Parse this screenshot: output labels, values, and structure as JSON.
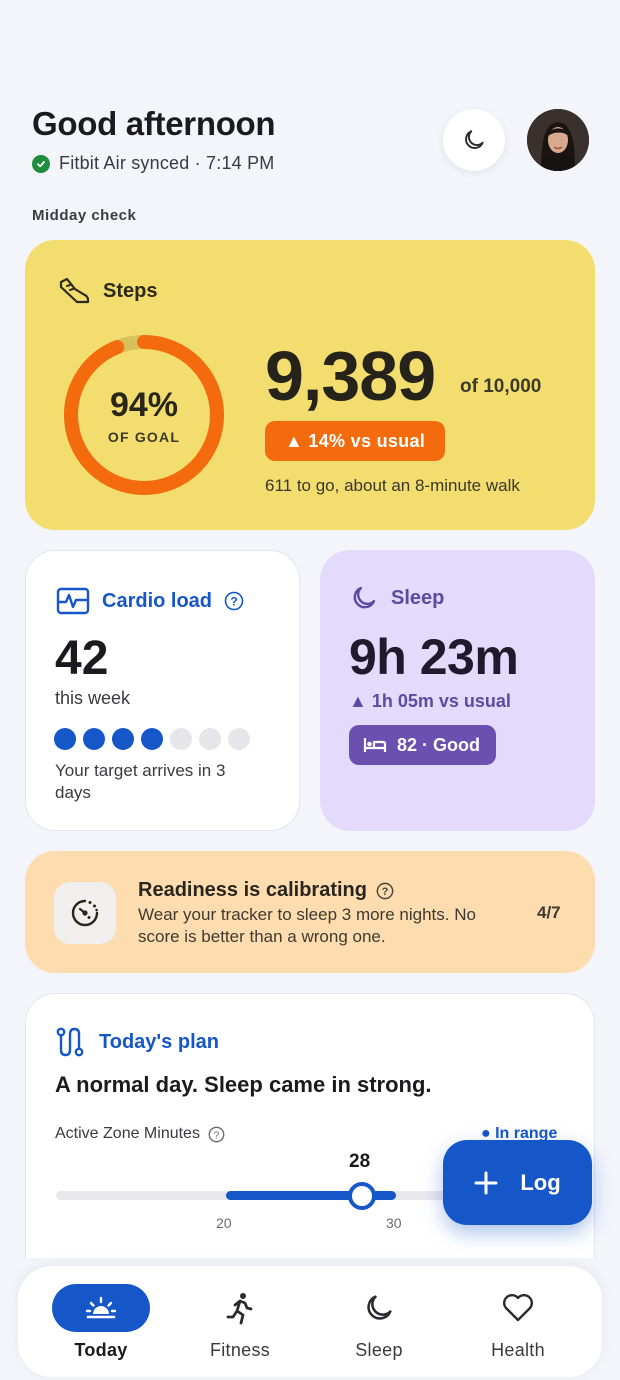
{
  "header": {
    "greeting": "Good afternoon",
    "sync_status": "Fitbit Air synced · 7:14 PM"
  },
  "section_label": "Midday check",
  "steps": {
    "title": "Steps",
    "goal_percent_label": "94%",
    "goal_percent": 0.94,
    "of_goal_label": "OF GOAL",
    "value": "9,389",
    "goal_label": "of 10,000",
    "badge": "▲ 14% vs usual",
    "note": "611 to go, about an 8-minute walk",
    "color_ring": "#f36b0d"
  },
  "cardio": {
    "title": "Cardio load",
    "value": "42",
    "sub": "this week",
    "filled_dots": 4,
    "total_dots": 7,
    "note": "Your target arrives in 3 days"
  },
  "sleep": {
    "title": "Sleep",
    "value": "9h 23m",
    "delta": "▲ 1h 05m vs usual",
    "score_badge": "82 · Good"
  },
  "readiness": {
    "title": "Readiness is calibrating",
    "text": "Wear your tracker to sleep 3 more nights. No score is better than a wrong one.",
    "count": "4/7"
  },
  "plan": {
    "title": "Today's plan",
    "headline": "A normal day. Sleep came in strong.",
    "azm_label": "Active Zone Minutes",
    "azm_status": "● In range",
    "azm_value": "28",
    "range_low": "20",
    "range_high": "30"
  },
  "fab": {
    "label": "Log"
  },
  "nav": {
    "items": [
      {
        "label": "Today",
        "icon": "sunrise-icon"
      },
      {
        "label": "Fitness",
        "icon": "running-icon"
      },
      {
        "label": "Sleep",
        "icon": "moon-icon"
      },
      {
        "label": "Health",
        "icon": "heart-icon"
      }
    ]
  }
}
